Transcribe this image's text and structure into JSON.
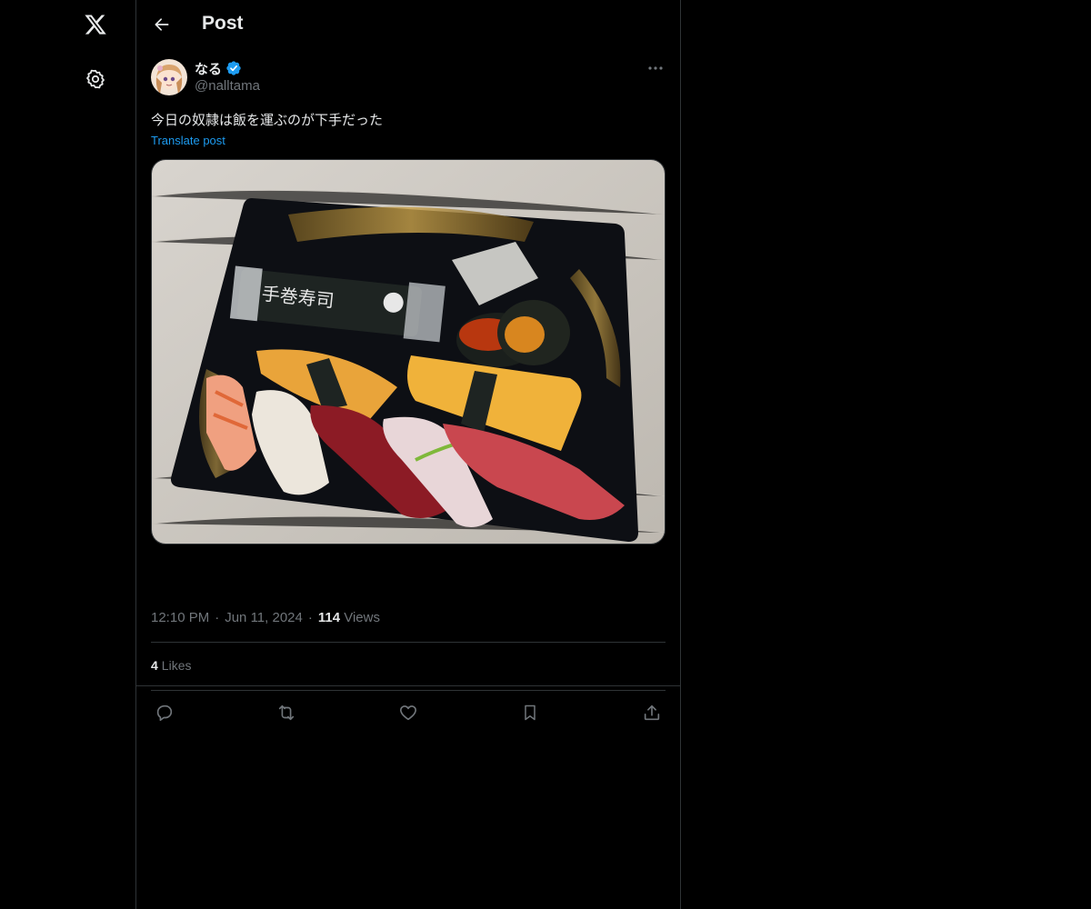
{
  "header": {
    "title": "Post"
  },
  "icons": {
    "logo": "x-logo-icon",
    "settings": "gear-icon",
    "back": "arrow-left-icon",
    "more": "more-horizontal-icon",
    "verified": "verified-badge-icon",
    "reply": "reply-icon",
    "repost": "repost-icon",
    "like": "heart-icon",
    "bookmark": "bookmark-icon",
    "share": "share-icon"
  },
  "post": {
    "author": {
      "display_name": "なる",
      "handle": "@nalltama",
      "verified": true
    },
    "text": "今日の奴隷は飯を運ぶのが下手だった",
    "translate_label": "Translate post",
    "time": "12:10 PM",
    "date": "Jun 11, 2024",
    "separator": "·",
    "views_count": "114",
    "views_label": "Views",
    "likes_count": "4",
    "likes_label": "Likes"
  },
  "colors": {
    "background": "#000000",
    "text": "#e7e9ea",
    "muted": "#71767b",
    "accent": "#1d9bf0",
    "border": "#2f3336"
  }
}
